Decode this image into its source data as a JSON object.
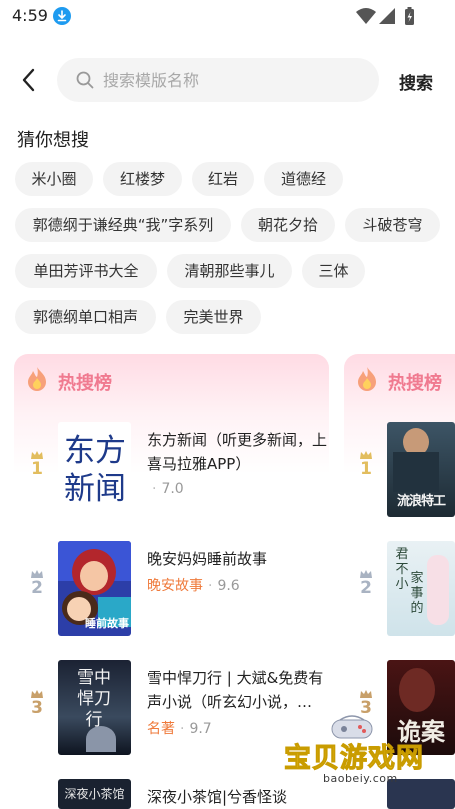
{
  "status_bar": {
    "time": "4:59",
    "icons": [
      "download-badge-icon",
      "wifi-icon",
      "signal-icon",
      "battery-icon"
    ]
  },
  "header": {
    "back_icon": "chevron-left-icon",
    "search_placeholder": "搜索模版名称",
    "search_value": "",
    "search_button": "搜索"
  },
  "guess": {
    "title": "猜你想搜",
    "chips": [
      "米小圈",
      "红楼梦",
      "红岩",
      "道德经",
      "郭德纲于谦经典“我”字系列",
      "朝花夕拾",
      "斗破苍穹",
      "单田芳评书大全",
      "清朝那些事儿",
      "三体",
      "郭德纲单口相声",
      "完美世界"
    ]
  },
  "hot_list": {
    "title": "热搜榜",
    "items": [
      {
        "rank": "1",
        "title": "东方新闻（听更多新闻，上喜马拉雅APP）",
        "tag": "",
        "score": "7.0",
        "cover_text": [
          "东方",
          "新闻"
        ]
      },
      {
        "rank": "2",
        "title": "晚安妈妈睡前故事",
        "tag": "晚安故事",
        "score": "9.6",
        "cover_text": [
          "睡前故事"
        ]
      },
      {
        "rank": "3",
        "title": "雪中悍刀行 | 大斌&免费有声小说（听玄幻小说，…",
        "tag": "名著",
        "score": "9.7",
        "cover_text": [
          "雪中",
          "悍刀行"
        ]
      },
      {
        "rank": "4",
        "title": "深夜小茶馆|兮香怪谈",
        "tag": "",
        "score": "",
        "cover_text": [
          "深夜小茶馆"
        ]
      }
    ]
  },
  "second_list": {
    "title": "热搜榜",
    "covers": [
      {
        "rank": "1",
        "cover_text": "流浪特工"
      },
      {
        "rank": "2",
        "cover_text": [
          "君",
          "不",
          "小",
          "家",
          "事",
          "的"
        ]
      },
      {
        "rank": "3",
        "cover_text": "诡案"
      }
    ]
  },
  "watermark": {
    "text": "宝贝游戏网",
    "url": "baobeiy.com"
  },
  "colors": {
    "accent_pink": "#f07a90",
    "tag_orange": "#ef7a3b",
    "gold_rank": "#e2bd5e",
    "silver_rank": "#a9b3c2",
    "bronze_rank": "#c8a06a"
  }
}
